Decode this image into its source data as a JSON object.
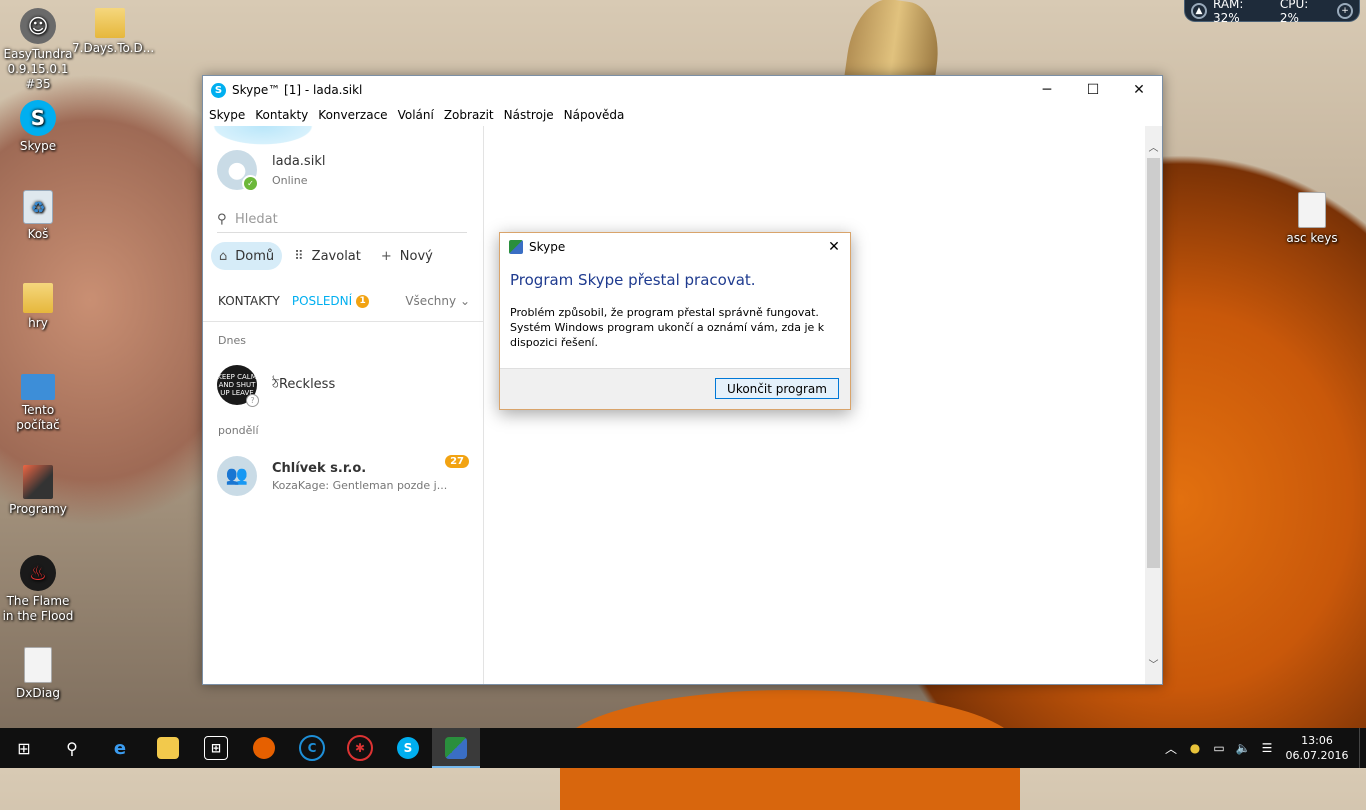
{
  "desktop": {
    "icons": [
      {
        "label": "EasyTundra 0.9.15.0.1 #35",
        "icon": "tundra-icon"
      },
      {
        "label": "7.Days.To.D...",
        "icon": "folder-icon"
      },
      {
        "label": "Skype",
        "icon": "skype-icon"
      },
      {
        "label": "Koš",
        "icon": "recycle-bin-icon"
      },
      {
        "label": "hry",
        "icon": "folder-icon"
      },
      {
        "label": "Tento počítač",
        "icon": "computer-icon"
      },
      {
        "label": "Programy",
        "icon": "programs-icon"
      },
      {
        "label": "The Flame in the Flood",
        "icon": "game-icon"
      },
      {
        "label": "DxDiag",
        "icon": "file-icon"
      },
      {
        "label": "asc keys",
        "icon": "file-icon"
      }
    ],
    "sysmon": {
      "ram": "RAM: 32%",
      "cpu": "CPU: 2%"
    }
  },
  "skype": {
    "title": "Skype™ [1] - lada.sikl",
    "menu": [
      "Skype",
      "Kontakty",
      "Konverzace",
      "Volání",
      "Zobrazit",
      "Nástroje",
      "Nápověda"
    ],
    "profile": {
      "name": "lada.sikl",
      "status": "Online"
    },
    "search_placeholder": "Hledat",
    "nav": {
      "home": "Domů",
      "call": "Zavolat",
      "new": "Nový"
    },
    "tabs": {
      "contacts": "KONTAKTY",
      "recent": "POSLEDNÍ",
      "recent_badge": "1",
      "filter": "Všechny"
    },
    "groups": {
      "today": "Dnes",
      "monday": "pondělí"
    },
    "contacts": [
      {
        "name": "ঠReckless",
        "avatar_text": "KEEP CALM AND SHUT UP LEAVE",
        "message": "",
        "badge": ""
      },
      {
        "name": "Chlívek s.r.o.",
        "message": "KozaKage: Gentleman pozde j...",
        "badge": "27"
      }
    ]
  },
  "dialog": {
    "title": "Skype",
    "heading": "Program Skype přestal pracovat.",
    "body": "Problém způsobil, že program přestal správně fungovat. Systém Windows program ukončí a oznámí vám, zda je k dispozici řešení.",
    "button": "Ukončit program"
  },
  "taskbar": {
    "time": "13:06",
    "date": "06.07.2016"
  },
  "colors": {
    "skype_blue": "#00aff0",
    "badge_orange": "#f2a312",
    "dialog_heading": "#1f3b8f",
    "taskbar": "#101010"
  }
}
